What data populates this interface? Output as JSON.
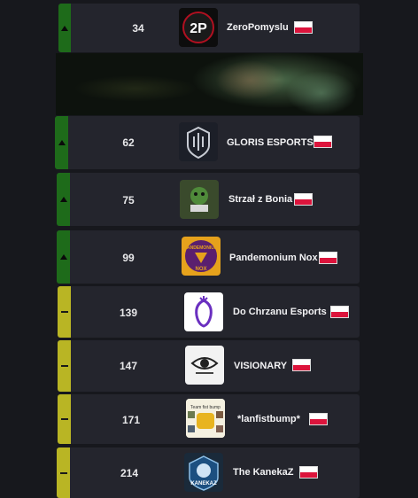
{
  "rows": [
    {
      "points": "34",
      "team": "ZeroPomyslu",
      "trend": "up",
      "logo": "2p-logo"
    },
    {
      "points": "62",
      "team": "GLORIS ESPORTS",
      "trend": "up",
      "logo": "gloris-logo"
    },
    {
      "points": "75",
      "team": "Strzał z Bonia",
      "trend": "up",
      "logo": "strzal-logo"
    },
    {
      "points": "99",
      "team": "Pandemonium Nox",
      "trend": "up",
      "logo": "pandemonium-logo"
    },
    {
      "points": "139",
      "team": "Do Chrzanu Esports",
      "trend": "same",
      "logo": "dochrzanu-logo"
    },
    {
      "points": "147",
      "team": "VISIONARY",
      "trend": "same",
      "logo": "visionary-logo"
    },
    {
      "points": "171",
      "team": "*lanfistbump*",
      "trend": "same",
      "logo": "lanfistbump-logo"
    },
    {
      "points": "214",
      "team": "The KanekaZ",
      "trend": "same",
      "logo": "kanekaz-logo"
    }
  ],
  "logo_texts": {
    "zeropomyslu": "2P",
    "pandemonium_top": "PANDEMONIUM",
    "pandemonium_bottom": "NOX",
    "kanekaz": "KANEKAZ",
    "lanfist": "Team fist bump"
  },
  "colors": {
    "trend_up": "#1e6b1a",
    "trend_same": "#b9b524",
    "row_bg": "#24252d",
    "page_bg": "#17181d"
  }
}
